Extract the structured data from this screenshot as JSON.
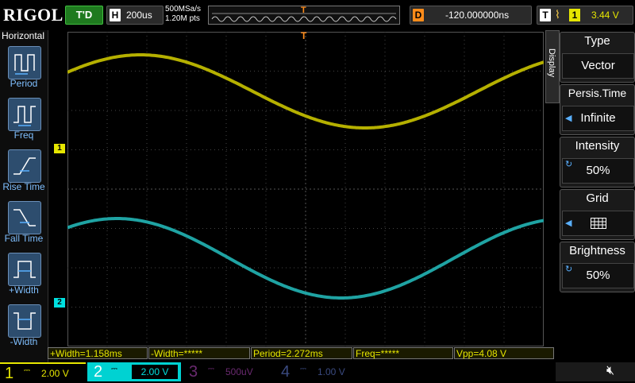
{
  "top_bar": {
    "brand": "RIGOL",
    "trigger_status": "T'D",
    "timebase_key": "H",
    "timebase_value": "200us",
    "sample_rate": "500MSa/s",
    "memory_depth": "1.20M pts",
    "trigger_marker": "T",
    "delay_key": "D",
    "delay_value": "-120.000000ns",
    "trigger_key": "T",
    "trigger_slope_icon": "rising-edge-icon",
    "trigger_source": "1",
    "trigger_level": "3.44 V"
  },
  "horizontal_menu": {
    "title": "Horizontal",
    "items": [
      {
        "label": "Period",
        "icon": "period-icon"
      },
      {
        "label": "Freq",
        "icon": "frequency-icon"
      },
      {
        "label": "Rise Time",
        "icon": "rise-time-icon"
      },
      {
        "label": "Fall Time",
        "icon": "fall-time-icon"
      },
      {
        "label": "+Width",
        "icon": "positive-width-icon"
      },
      {
        "label": "-Width",
        "icon": "negative-width-icon"
      }
    ]
  },
  "display_menu": {
    "tab_label": "Display",
    "items": [
      {
        "title": "Type",
        "value": "Vector"
      },
      {
        "title": "Persis.Time",
        "value": "Infinite"
      },
      {
        "title": "Intensity",
        "value": "50%"
      },
      {
        "title": "Grid",
        "value": "",
        "icon": "grid-icon"
      },
      {
        "title": "Brightness",
        "value": "50%"
      }
    ]
  },
  "waveforms": {
    "ch1_marker": "1",
    "ch2_marker": "2",
    "ch1_color": "#b5b000",
    "ch2_color": "#1fa3a3"
  },
  "measurements": [
    {
      "label": "+Width=1.158ms"
    },
    {
      "label": "-Width=*****"
    },
    {
      "label": "Period=2.272ms"
    },
    {
      "label": "Freq=*****"
    },
    {
      "label": "Vpp=4.08 V"
    }
  ],
  "channels": [
    {
      "num": "1",
      "scale": "2.00 V",
      "color": "#e6e600",
      "active": true
    },
    {
      "num": "2",
      "scale": "2.00 V",
      "color": "#00e0e0",
      "active": true
    },
    {
      "num": "3",
      "scale": "500uV",
      "color": "#9b3ea0",
      "active": false
    },
    {
      "num": "4",
      "scale": "1.00 V",
      "color": "#5a6fb0",
      "active": false
    }
  ],
  "sound_icon": "speaker-muted-icon"
}
